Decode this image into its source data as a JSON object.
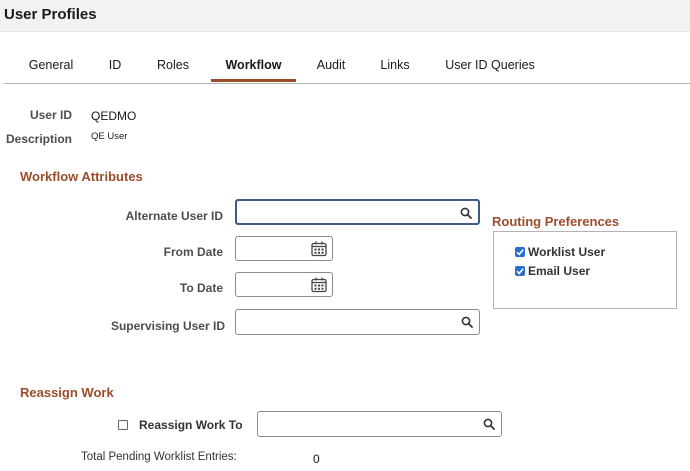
{
  "header": {
    "title": "User Profiles"
  },
  "tabs": [
    {
      "label": "General"
    },
    {
      "label": "ID"
    },
    {
      "label": "Roles"
    },
    {
      "label": "Workflow"
    },
    {
      "label": "Audit"
    },
    {
      "label": "Links"
    },
    {
      "label": "User ID Queries"
    }
  ],
  "active_tab": "Workflow",
  "user": {
    "id_label": "User ID",
    "id_value": "QEDMO",
    "desc_label": "Description",
    "desc_value": "QE User"
  },
  "workflow": {
    "title": "Workflow Attributes",
    "alternate_label": "Alternate User ID",
    "alternate_value": "",
    "from_label": "From Date",
    "from_value": "",
    "to_label": "To Date",
    "to_value": "",
    "supervisor_label": "Supervising User ID",
    "supervisor_value": ""
  },
  "routing": {
    "title": "Routing Preferences",
    "worklist_label": "Worklist User",
    "worklist_checked": true,
    "email_label": "Email User",
    "email_checked": true
  },
  "reassign": {
    "title": "Reassign Work",
    "checkbox_label": "Reassign Work To",
    "checked": false,
    "value": "",
    "pending_label": "Total Pending Worklist Entries:",
    "pending_value": "0"
  },
  "icons": {
    "search": "search-icon",
    "calendar": "calendar-icon",
    "check": "checkmark-icon"
  },
  "colors": {
    "accent": "#9b4d2b",
    "focus": "#3d5c8a",
    "checkbox": "#2a6ec8"
  }
}
